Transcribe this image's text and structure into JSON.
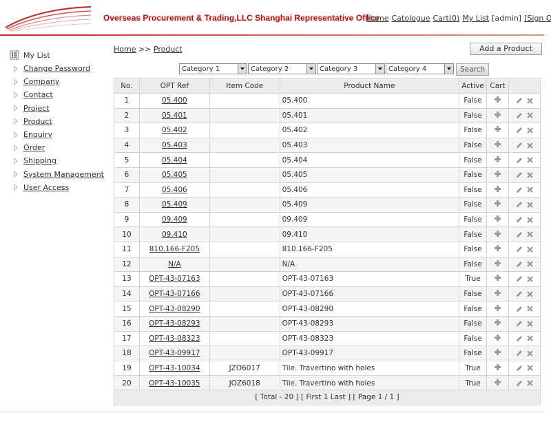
{
  "header": {
    "title": "Overseas Procurement & Trading,LLC Shanghai Representative Office",
    "nav": {
      "home": "Home",
      "catalogue": "Catologue",
      "cart": "Cart(0)",
      "mylist": "My List",
      "user": "[admin]",
      "signout": "[Sign Out]"
    }
  },
  "sidebar": {
    "head": "My List",
    "items": [
      "Change Password",
      "Company",
      "Contact",
      "Project",
      "Product",
      "Enquiry",
      "Order",
      "Shipping",
      "System Management",
      "User Access"
    ]
  },
  "breadcrumb": {
    "home": "Home",
    "sep": ">>",
    "current": "Product"
  },
  "add_button": "Add a Product",
  "filters": {
    "cat1": "Category 1",
    "cat2": "Category 2",
    "cat3": "Category 3",
    "cat4": "Category 4",
    "search": "Search"
  },
  "table": {
    "headers": {
      "no": "No.",
      "ref": "OPT Ref",
      "code": "Item Code",
      "name": "Product Name",
      "active": "Active",
      "cart": "Cart"
    },
    "rows": [
      {
        "no": "1",
        "ref": "05.400",
        "code": "",
        "name": "05.400",
        "active": "False"
      },
      {
        "no": "2",
        "ref": "05.401",
        "code": "",
        "name": "05.401",
        "active": "False"
      },
      {
        "no": "3",
        "ref": "05.402",
        "code": "",
        "name": "05.402",
        "active": "False"
      },
      {
        "no": "4",
        "ref": "05.403",
        "code": "",
        "name": "05.403",
        "active": "False"
      },
      {
        "no": "5",
        "ref": "05.404",
        "code": "",
        "name": "05.404",
        "active": "False"
      },
      {
        "no": "6",
        "ref": "05.405",
        "code": "",
        "name": "05.405",
        "active": "False"
      },
      {
        "no": "7",
        "ref": "05.406",
        "code": "",
        "name": "05.406",
        "active": "False"
      },
      {
        "no": "8",
        "ref": "05.409",
        "code": "",
        "name": "05.409",
        "active": "False"
      },
      {
        "no": "9",
        "ref": "09.409",
        "code": "",
        "name": "09.409",
        "active": "False"
      },
      {
        "no": "10",
        "ref": "09.410",
        "code": "",
        "name": "09.410",
        "active": "False"
      },
      {
        "no": "11",
        "ref": "810.166-F205",
        "code": "",
        "name": "810.166-F205",
        "active": "False"
      },
      {
        "no": "12",
        "ref": "N/A",
        "code": "",
        "name": "N/A",
        "active": "False"
      },
      {
        "no": "13",
        "ref": "OPT-43-07163",
        "code": "",
        "name": "OPT-43-07163",
        "active": "True"
      },
      {
        "no": "14",
        "ref": "OPT-43-07166",
        "code": "",
        "name": "OPT-43-07166",
        "active": "False"
      },
      {
        "no": "15",
        "ref": "OPT-43-08290",
        "code": "",
        "name": "OPT-43-08290",
        "active": "False"
      },
      {
        "no": "16",
        "ref": "OPT-43-08293",
        "code": "",
        "name": "OPT-43-08293",
        "active": "False"
      },
      {
        "no": "17",
        "ref": "OPT-43-08323",
        "code": "",
        "name": "OPT-43-08323",
        "active": "False"
      },
      {
        "no": "18",
        "ref": "OPT-43-09917",
        "code": "",
        "name": "OPT-43-09917",
        "active": "False"
      },
      {
        "no": "19",
        "ref": "OPT-43-10034",
        "code": "JZO6017",
        "name": "Tile. Travertino with holes",
        "active": "True"
      },
      {
        "no": "20",
        "ref": "OPT-43-10035",
        "code": "JOZ6018",
        "name": "Tile. Travertino with holes",
        "active": "True"
      }
    ]
  },
  "pager": "[ Total - 20 ]    [ First 1 Last ]    [ Page 1 / 1 ]",
  "icons": {
    "cart": "plus-icon",
    "edit": "pencil-icon",
    "delete": "cross-icon",
    "sidebar_head": "list-icon",
    "sidebar_item": "triangle-right-icon"
  }
}
